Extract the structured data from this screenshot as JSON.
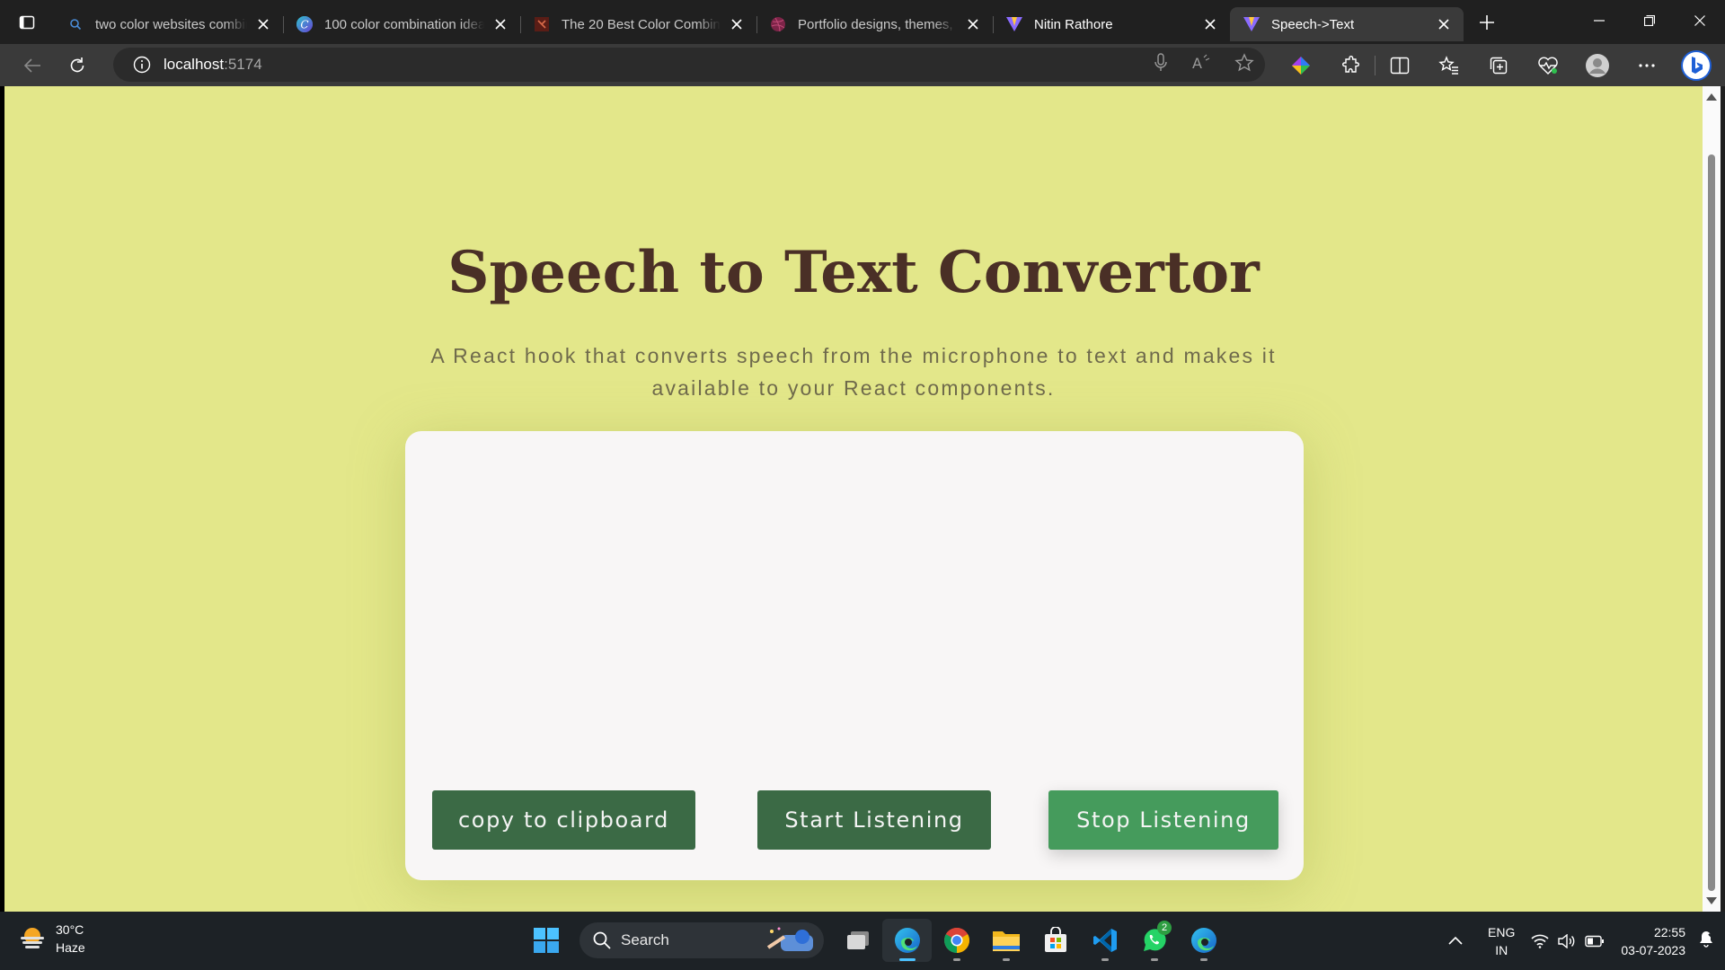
{
  "browser": {
    "tabs": [
      {
        "title": "two color websites combination",
        "favicon": "search-icon"
      },
      {
        "title": "100 color combination ideas",
        "favicon": "canva-icon"
      },
      {
        "title": "The 20 Best Color Combinations",
        "favicon": "site-icon"
      },
      {
        "title": "Portfolio designs, themes, templates",
        "favicon": "dribbble-icon"
      },
      {
        "title": "Nitin Rathore",
        "favicon": "vite-icon"
      },
      {
        "title": "Speech->Text",
        "favicon": "vite-icon",
        "active": true
      }
    ],
    "address": {
      "host": "localhost",
      "port": ":5174"
    }
  },
  "page": {
    "title": "Speech to Text Convertor",
    "subtitle": "A React hook that converts speech from the microphone to text and makes it available to your React components.",
    "transcript": "",
    "buttons": {
      "copy": "copy to clipboard",
      "start": "Start Listening",
      "stop": "Stop Listening"
    }
  },
  "taskbar": {
    "weather": {
      "temp": "30°C",
      "condition": "Haze"
    },
    "search_label": "Search",
    "whatsapp_badge": "2",
    "lang": {
      "line1": "ENG",
      "line2": "IN"
    },
    "time": "22:55",
    "date": "03-07-2023"
  },
  "colors": {
    "page_bg": "#e3e78a",
    "title": "#4a2f26",
    "button_dark": "#3b6a45",
    "button_light": "#459b5c",
    "card_bg": "#f8f6f6"
  }
}
